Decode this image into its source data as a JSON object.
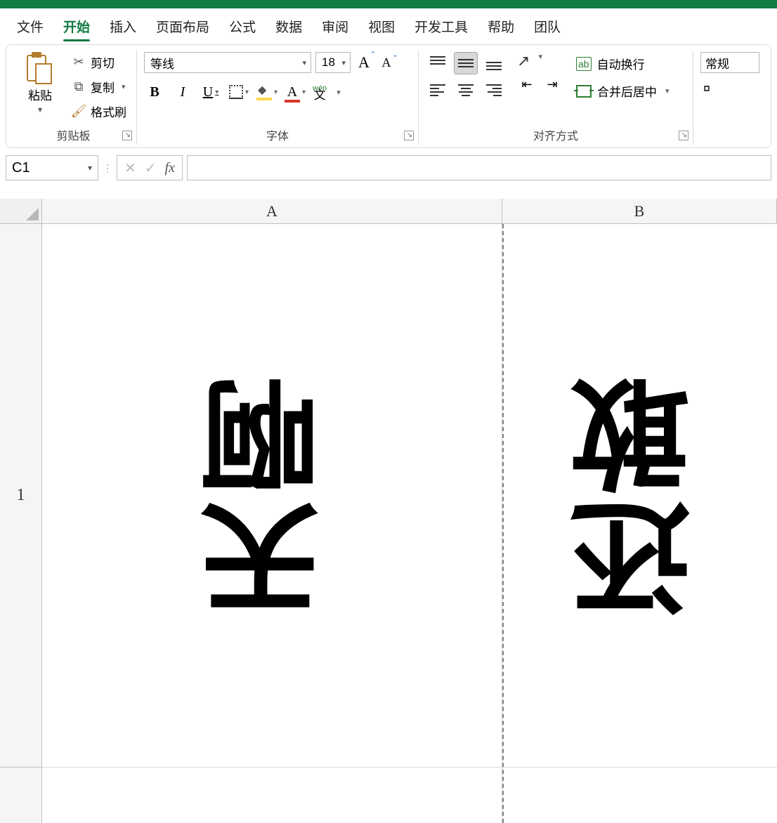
{
  "menu": {
    "file": "文件",
    "home": "开始",
    "insert": "插入",
    "pagelayout": "页面布局",
    "formulas": "公式",
    "data": "数据",
    "review": "审阅",
    "view": "视图",
    "developer": "开发工具",
    "help": "帮助",
    "team": "团队"
  },
  "clipboard": {
    "paste": "粘贴",
    "cut": "剪切",
    "copy": "复制",
    "formatpainter": "格式刷",
    "group": "剪贴板"
  },
  "font": {
    "name": "等线",
    "size": "18",
    "group": "字体",
    "bold": "B",
    "italic": "I",
    "underline": "U",
    "fontcolor_letter": "A",
    "grow": "A",
    "shrink": "A",
    "phonetic_py": "wén",
    "phonetic_cn": "文"
  },
  "alignment": {
    "wrap": "自动换行",
    "merge": "合并后居中",
    "group": "对齐方式"
  },
  "number": {
    "format": "常规"
  },
  "formulabar": {
    "namebox": "C1",
    "cancel": "✕",
    "accept": "✓",
    "fx": "fx",
    "value": ""
  },
  "grid": {
    "colA": "A",
    "colB": "B",
    "row1": "1",
    "A1": "天啊",
    "B1": "还敢"
  }
}
